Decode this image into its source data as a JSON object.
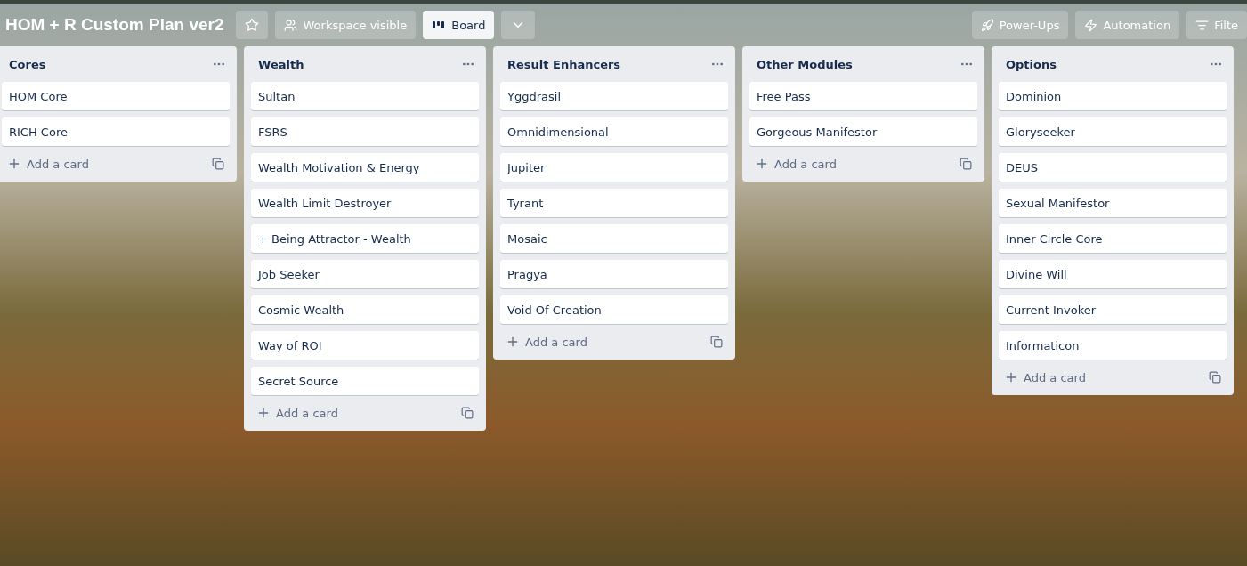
{
  "board": {
    "title": "HOM + R Custom Plan ver2",
    "starred": false,
    "visibility": "Workspace visible",
    "views": [
      {
        "label": "Board",
        "selected": true
      }
    ],
    "actions": [
      "Power-Ups",
      "Automation",
      "Filte"
    ]
  },
  "lists": [
    {
      "title": "Cores",
      "cards": [
        "HOM Core",
        "RICH Core"
      ],
      "add_label": "Add a card"
    },
    {
      "title": "Wealth",
      "cards": [
        "Sultan",
        "FSRS",
        "Wealth Motivation & Energy",
        "Wealth Limit Destroyer",
        "+ Being Attractor - Wealth",
        "Job Seeker",
        "Cosmic Wealth",
        "Way of ROI",
        "Secret Source"
      ],
      "add_label": "Add a card"
    },
    {
      "title": "Result Enhancers",
      "cards": [
        "Yggdrasil",
        "Omnidimensional",
        "Jupiter",
        "Tyrant",
        "Mosaic",
        "Pragya",
        "Void Of Creation"
      ],
      "add_label": "Add a card"
    },
    {
      "title": "Other Modules",
      "cards": [
        "Free Pass",
        "Gorgeous Manifestor"
      ],
      "add_label": "Add a card"
    },
    {
      "title": "Options",
      "cards": [
        "Dominion",
        "Gloryseeker",
        "DEUS",
        "Sexual Manifestor",
        "Inner Circle Core",
        "Divine Will",
        "Current Invoker",
        "Informaticon"
      ],
      "add_label": "Add a card"
    }
  ]
}
